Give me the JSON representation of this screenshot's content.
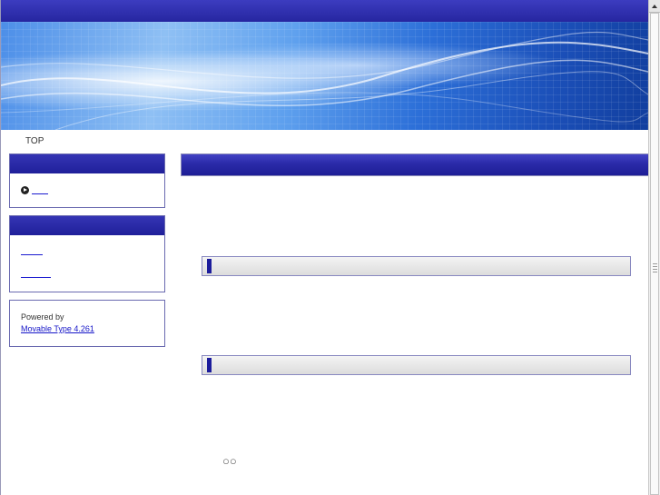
{
  "breadcrumb": {
    "top_label": "TOP"
  },
  "sidebar": {
    "powered_by_label": "Powered by",
    "powered_by_link": "Movable Type 4.261"
  },
  "footer": {
    "mark": "○○"
  },
  "colors": {
    "header_blue": "#2a2aa8",
    "link_blue": "#1515c8",
    "bar_gray": "#e0e0e0"
  },
  "icons": {
    "arrow_link": "circle-arrow-icon",
    "scroll_up": "scroll-up-arrow-icon"
  }
}
